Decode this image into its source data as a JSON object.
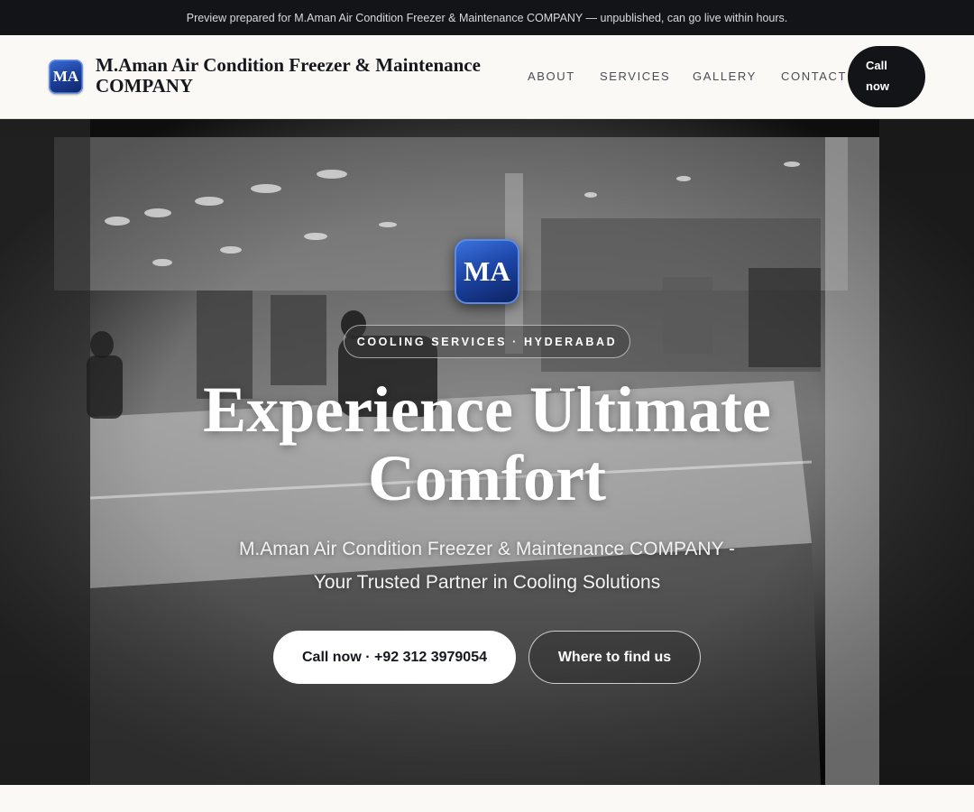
{
  "topbar": {
    "text": "Preview prepared for M.Aman Air Condition Freezer & Maintenance COMPANY — unpublished, can go live within hours."
  },
  "header": {
    "logo_initials": "MA",
    "brand_name": "M.Aman Air Condition Freezer & Maintenance COMPANY",
    "nav": [
      "ABOUT",
      "SERVICES",
      "GALLERY",
      "CONTACT"
    ],
    "call_label_line1": "Call",
    "call_label_line2": "now"
  },
  "hero": {
    "logo_initials": "MA",
    "tag": "COOLING SERVICES · HYDERABAD",
    "title_line1": "Experience Ultimate",
    "title_line2": "Comfort",
    "subtitle_line1": "M.Aman Air Condition Freezer & Maintenance COMPANY -",
    "subtitle_line2": "Your Trusted Partner in Cooling Solutions",
    "primary_button": "Call now · +92 312 3979054",
    "secondary_button": "Where to find us"
  },
  "colors": {
    "dark": "#121418",
    "page_bg": "#faf9f6",
    "brand_blue": "#1d46a8"
  }
}
